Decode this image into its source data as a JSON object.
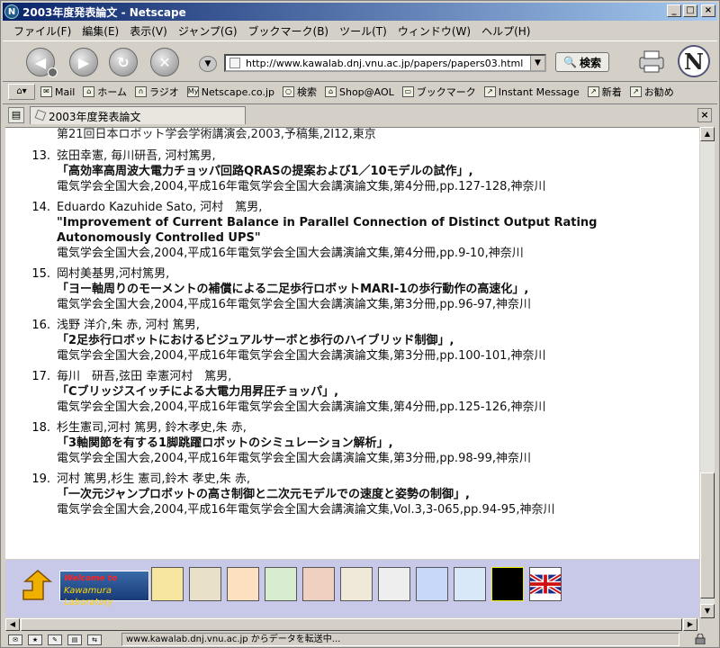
{
  "window": {
    "title": "2003年度発表論文 - Netscape",
    "app_icon": "N"
  },
  "menu": [
    "ファイル(F)",
    "編集(E)",
    "表示(V)",
    "ジャンプ(G)",
    "ブックマーク(B)",
    "ツール(T)",
    "ウィンドウ(W)",
    "ヘルプ(H)"
  ],
  "nav": {
    "url": "http://www.kawalab.dnj.vnu.ac.jp/papers/papers03.html",
    "search_label": "検索",
    "throbber": "N"
  },
  "personal_toolbar": [
    "Mail",
    "ホーム",
    "ラジオ",
    "Netscape.co.jp",
    "検索",
    "Shop@AOL",
    "ブックマーク",
    "Instant Message",
    "新着",
    "お勧め"
  ],
  "tab": {
    "label": "2003年度発表論文"
  },
  "content": {
    "partial_line": "第21回日本ロボット学会学術講演会,2003,予稿集,2I12,東京",
    "publications": [
      {
        "num": "13.",
        "authors": "弦田幸憲, 毎川研吾, 河村篤男,",
        "title": "「高効率高周波大電力チョッパ回路QRASの提案および1／10モデルの試作」,",
        "venue": "電気学会全国大会,2004,平成16年電気学会全国大会講演論文集,第4分冊,pp.127-128,神奈川"
      },
      {
        "num": "14.",
        "authors": "Eduardo Kazuhide Sato, 河村　篤男,",
        "title": "\"Improvement of Current Balance in Parallel Connection of Distinct Output Rating Autonomously Controlled UPS\"",
        "venue": "電気学会全国大会,2004,平成16年電気学会全国大会講演論文集,第4分冊,pp.9-10,神奈川"
      },
      {
        "num": "15.",
        "authors": "岡村美基男,河村篤男,",
        "title": "「ヨー軸周りのモーメントの補償による二足歩行ロボットMARI-1の歩行動作の高速化」,",
        "venue": "電気学会全国大会,2004,平成16年電気学会全国大会講演論文集,第3分冊,pp.96-97,神奈川"
      },
      {
        "num": "16.",
        "authors": "浅野 洋介,朱 赤, 河村 篤男,",
        "title": "「2足歩行ロボットにおけるビジュアルサーボと歩行のハイブリッド制御」,",
        "venue": "電気学会全国大会,2004,平成16年電気学会全国大会講演論文集,第3分冊,pp.100-101,神奈川"
      },
      {
        "num": "17.",
        "authors": "毎川　研吾,弦田 幸憲河村　篤男,",
        "title": "「Cブリッジスイッチによる大電力用昇圧チョッパ」,",
        "venue": "電気学会全国大会,2004,平成16年電気学会全国大会講演論文集,第4分冊,pp.125-126,神奈川"
      },
      {
        "num": "18.",
        "authors": "杉生憲司,河村 篤男, 鈴木孝史,朱 赤,",
        "title": "「3軸関節を有する1脚跳躍ロボットのシミュレーション解析」,",
        "venue": "電気学会全国大会,2004,平成16年電気学会全国大会講演論文集,第3分冊,pp.98-99,神奈川"
      },
      {
        "num": "19.",
        "authors": "河村 篤男,杉生 憲司,鈴木 孝史,朱 赤,",
        "title": "「一次元ジャンプロボットの高さ制御と二次元モデルでの速度と姿勢の制御」,",
        "venue": "電気学会全国大会,2004,平成16年電気学会全国大会講演論文集,Vol.3,3-065,pp.94-95,神奈川"
      }
    ]
  },
  "lab_logo": {
    "welcome": "Welcome to",
    "name": "Kawamura Laboratory"
  },
  "status": {
    "text": "www.kawalab.dnj.vnu.ac.jp からデータを転送中..."
  }
}
